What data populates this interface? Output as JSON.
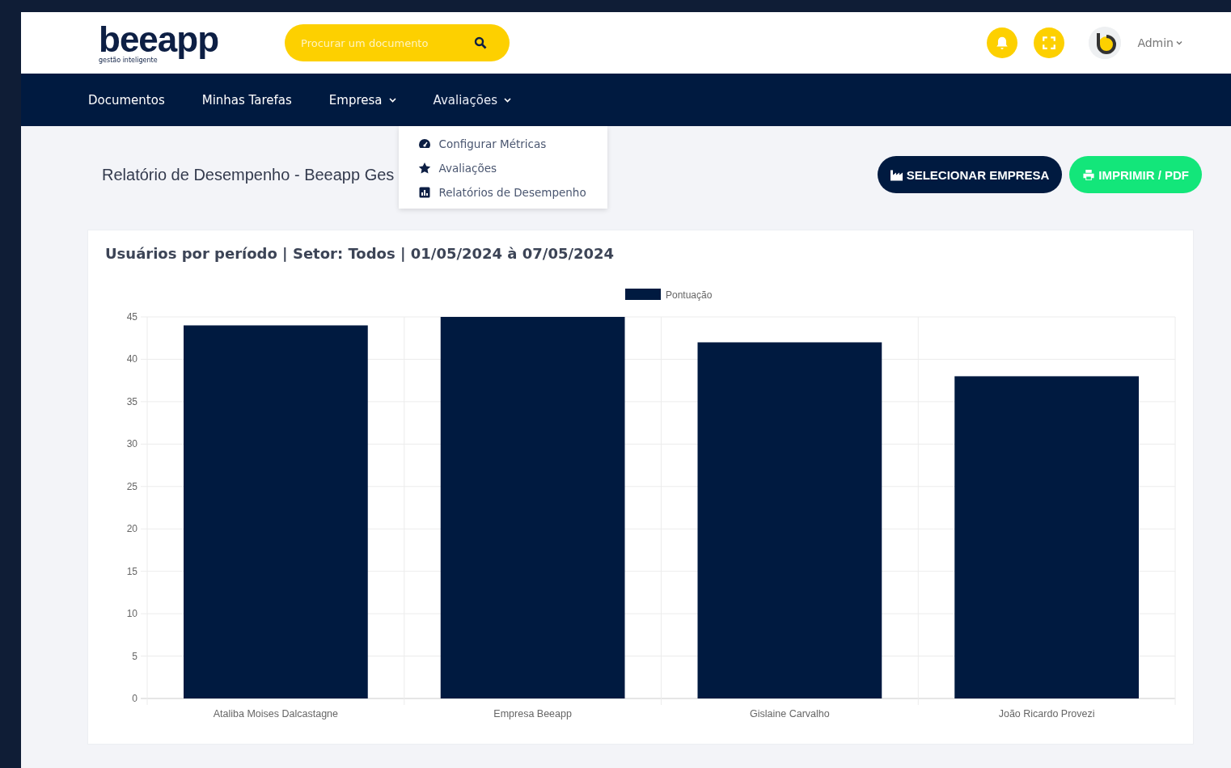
{
  "header": {
    "logo": "beeapp",
    "tagline": "gestão inteligente",
    "search": {
      "placeholder": "Procurar um documento"
    },
    "user": "Admin"
  },
  "nav": [
    {
      "label": "Documentos",
      "dropdown": false,
      "expanded": false
    },
    {
      "label": "Minhas Tarefas",
      "dropdown": false,
      "expanded": false
    },
    {
      "label": "Empresa",
      "dropdown": true,
      "expanded": false
    },
    {
      "label": "Avaliações",
      "dropdown": true,
      "expanded": true,
      "menu": [
        {
          "kind": "gauge",
          "label": "Configurar Métricas"
        },
        {
          "kind": "star",
          "label": "Avaliações"
        },
        {
          "kind": "report",
          "label": "Relatórios de Desempenho"
        }
      ]
    }
  ],
  "page_title": "Relatório de Desempenho - Beeapp Ges",
  "buttons": [
    {
      "kind": "factory",
      "label": "SELECIONAR EMPRESA"
    },
    {
      "kind": "print",
      "label": "IMPRIMIR / PDF"
    }
  ],
  "card": {
    "title": "Usuários por período | Setor: Todos | 01/05/2024 à 07/05/2024",
    "chart_data": {
      "type": "bar",
      "categories": [
        "Ataliba Moises Dalcastagne",
        "Empresa Beeapp",
        "Gislaine Carvalho",
        "João Ricardo Provezi"
      ],
      "series": [
        {
          "name": "Pontuação",
          "color": "#001a40",
          "values": [
            44,
            45,
            42,
            38
          ]
        }
      ],
      "grid": true,
      "ylim": [
        0,
        45
      ],
      "yticks": [
        0,
        5,
        10,
        15,
        20,
        25,
        30,
        35,
        40,
        45
      ]
    }
  }
}
